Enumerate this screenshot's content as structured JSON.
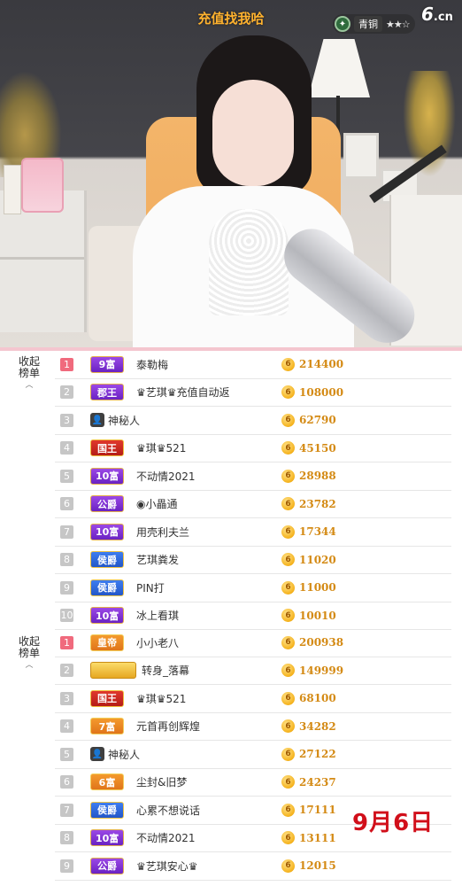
{
  "stream": {
    "overlay_title": "充值找我哈",
    "rank_label": "青铜",
    "rank_stars": "★★☆",
    "logo_main": "6",
    "logo_suffix": ".cn"
  },
  "boards": [
    {
      "collapse_label_line1": "收起",
      "collapse_label_line2": "榜单",
      "collapse_chevron": "︿",
      "rows": [
        {
          "rank": "1",
          "badge": "9富",
          "badge_style": "purple",
          "name": "泰勒梅",
          "score": "214400"
        },
        {
          "rank": "2",
          "badge": "郡王",
          "badge_style": "purple",
          "name": "♛艺琪♛充值自动返",
          "score": "108000"
        },
        {
          "rank": "3",
          "badge": "",
          "badge_style": "ghost",
          "name": "神秘人",
          "score": "62790"
        },
        {
          "rank": "4",
          "badge": "国王",
          "badge_style": "red",
          "name": "♛琪♛521",
          "score": "45150"
        },
        {
          "rank": "5",
          "badge": "10富",
          "badge_style": "purple",
          "name": "不动情2021",
          "score": "28988"
        },
        {
          "rank": "6",
          "badge": "公爵",
          "badge_style": "purple",
          "name": "◉小畾通",
          "score": "23782"
        },
        {
          "rank": "7",
          "badge": "10富",
          "badge_style": "purple",
          "name": "用壳利夫兰",
          "score": "17344"
        },
        {
          "rank": "8",
          "badge": "侯爵",
          "badge_style": "blue",
          "name": "艺琪粪发",
          "score": "11020"
        },
        {
          "rank": "9",
          "badge": "侯爵",
          "badge_style": "blue",
          "name": "PIN打",
          "score": "11000"
        },
        {
          "rank": "10",
          "badge": "10富",
          "badge_style": "purple",
          "name": "冰上看琪",
          "score": "10010"
        }
      ]
    },
    {
      "collapse_label_line1": "收起",
      "collapse_label_line2": "榜单",
      "collapse_chevron": "︿",
      "rows": [
        {
          "rank": "1",
          "badge": "皇帝",
          "badge_style": "orange",
          "name": "小小老八",
          "score": "200938"
        },
        {
          "rank": "2",
          "badge": "",
          "badge_style": "gold",
          "name": "转身_落幕",
          "score": "149999"
        },
        {
          "rank": "3",
          "badge": "国王",
          "badge_style": "red",
          "name": "♛琪♛521",
          "score": "68100"
        },
        {
          "rank": "4",
          "badge": "7富",
          "badge_style": "orange",
          "name": "元首再创辉煌",
          "score": "34282"
        },
        {
          "rank": "5",
          "badge": "",
          "badge_style": "ghost",
          "name": "神秘人",
          "score": "27122"
        },
        {
          "rank": "6",
          "badge": "6富",
          "badge_style": "orange",
          "name": "尘封&旧梦",
          "score": "24237"
        },
        {
          "rank": "7",
          "badge": "侯爵",
          "badge_style": "blue",
          "name": "心累不想说话",
          "score": "17111"
        },
        {
          "rank": "8",
          "badge": "10富",
          "badge_style": "purple",
          "name": "不动情2021",
          "score": "13111"
        },
        {
          "rank": "9",
          "badge": "公爵",
          "badge_style": "purple",
          "name": "♛艺琪安心♛",
          "score": "12015"
        }
      ]
    }
  ],
  "coin_glyph": "6",
  "ghost_glyph": "👤",
  "date_label": "9月6日",
  "colors": {
    "first_rank": "#f06a7d",
    "score": "#d48a14",
    "date": "#d10f1a",
    "overlay_title": "#ffb22e"
  }
}
